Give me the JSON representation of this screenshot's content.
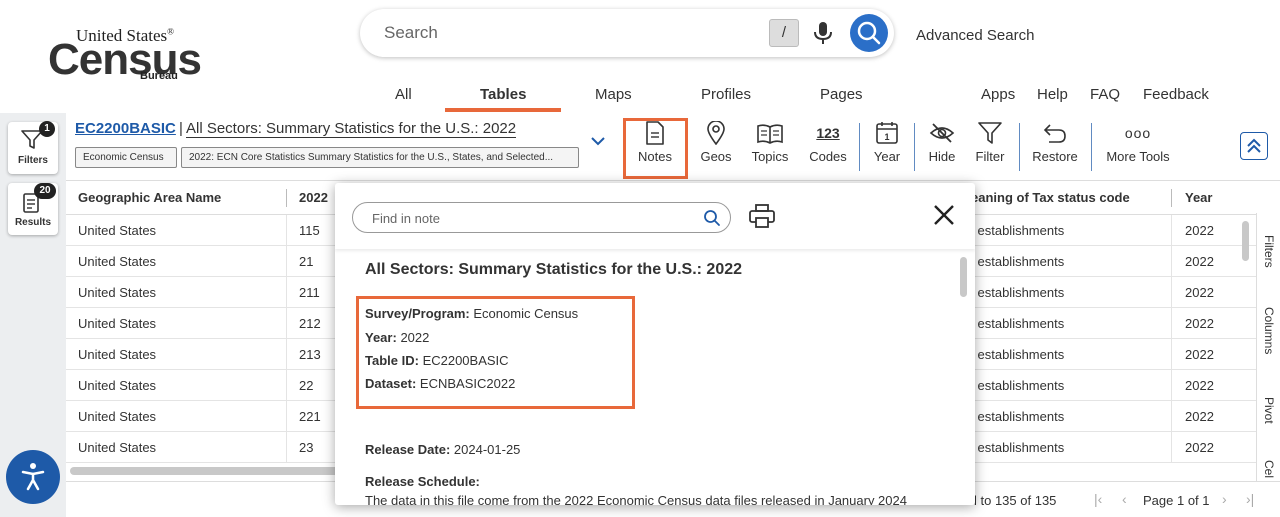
{
  "header": {
    "logo": {
      "line1": "United States",
      "reg": "®",
      "line2": "Census",
      "line3": "Bureau"
    },
    "search": {
      "placeholder": "Search",
      "shortcut": "/"
    },
    "advanced_search": "Advanced Search",
    "nav_left": [
      "All",
      "Tables",
      "Maps",
      "Profiles",
      "Pages"
    ],
    "nav_right": [
      "Apps",
      "Help",
      "FAQ",
      "Feedback"
    ],
    "active_tab": "Tables",
    "accent_color": "#e8683a"
  },
  "rail": {
    "filters": {
      "label": "Filters",
      "badge": "1"
    },
    "results": {
      "label": "Results",
      "badge": "20"
    }
  },
  "toolbar": {
    "table_id": "EC2200BASIC",
    "separator": "|",
    "table_title": "All Sectors: Summary Statistics for the U.S.: 2022",
    "chips": [
      "Economic Census",
      "2022: ECN Core Statistics Summary Statistics for the U.S., States, and Selected..."
    ],
    "tools": [
      {
        "label": "Notes",
        "icon": "document-icon"
      },
      {
        "label": "Geos",
        "icon": "map-pin-icon"
      },
      {
        "label": "Topics",
        "icon": "book-icon"
      },
      {
        "label": "Codes",
        "icon": "codes-icon",
        "glyph": "123"
      },
      {
        "label": "Year",
        "icon": "calendar-icon",
        "glyph": "1"
      },
      {
        "label": "Hide",
        "icon": "eye-slash-icon"
      },
      {
        "label": "Filter",
        "icon": "funnel-icon"
      },
      {
        "label": "Restore",
        "icon": "undo-icon"
      },
      {
        "label": "More Tools",
        "icon": "more-dots-icon",
        "glyph": "ooo"
      }
    ]
  },
  "grid": {
    "columns": [
      "Geographic Area Name",
      "2022",
      "eaning of Tax status code",
      "Year"
    ],
    "rows": [
      [
        "United States",
        "115",
        "l establishments",
        "2022"
      ],
      [
        "United States",
        "21",
        "l establishments",
        "2022"
      ],
      [
        "United States",
        "211",
        "l establishments",
        "2022"
      ],
      [
        "United States",
        "212",
        "l establishments",
        "2022"
      ],
      [
        "United States",
        "213",
        "l establishments",
        "2022"
      ],
      [
        "United States",
        "22",
        "l establishments",
        "2022"
      ],
      [
        "United States",
        "221",
        "l establishments",
        "2022"
      ],
      [
        "United States",
        "23",
        "l establishments",
        "2022"
      ]
    ]
  },
  "side_tabs": [
    "Filters",
    "Columns",
    "Pivot",
    "Cel"
  ],
  "footer": {
    "range": "l to 135 of 135",
    "page": "Page 1 of 1"
  },
  "notes": {
    "find_placeholder": "Find in note",
    "title": "All Sectors: Summary Statistics for the U.S.: 2022",
    "survey_label": "Survey/Program:",
    "survey_value": "Economic Census",
    "year_label": "Year:",
    "year_value": "2022",
    "tableid_label": "Table ID:",
    "tableid_value": "EC2200BASIC",
    "dataset_label": "Dataset:",
    "dataset_value": "ECNBASIC2022",
    "release_date_label": "Release Date:",
    "release_date_value": "2024-01-25",
    "release_schedule_label": "Release Schedule:",
    "release_schedule_text": "The data in this file come from the 2022 Economic Census data files released in January 2024"
  }
}
